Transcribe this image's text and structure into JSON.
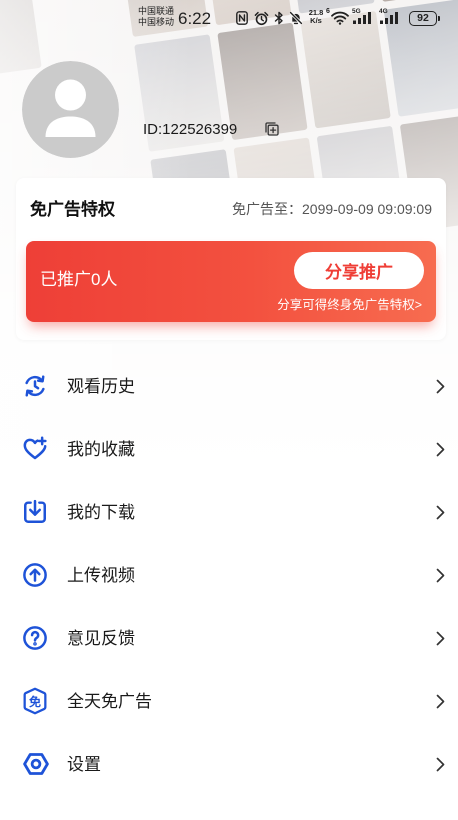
{
  "status_bar": {
    "carrier_1": "中国联通",
    "carrier_2": "中国移动",
    "time": "6:22",
    "net_speed_value": "21.8",
    "net_speed_unit": "K/s",
    "wifi_badge": "6",
    "signal_1_label": "5G",
    "signal_2_label": "4G",
    "battery_level": "92",
    "icons": [
      "nfc-icon",
      "alarm-icon",
      "bluetooth-icon",
      "bell-mute-icon",
      "wifi-icon",
      "signal-5g-icon",
      "signal-4g-icon",
      "battery-icon"
    ]
  },
  "profile": {
    "avatar_icon": "default-avatar-person-icon",
    "id_text": "ID:122526399",
    "copy_icon": "copy-icon"
  },
  "ad_free_card": {
    "title": "免广告特权",
    "expiry_text": "免广告至：2099-09-09 09:09:09",
    "promo_banner": {
      "promoted_text": "已推广0人",
      "share_button_label": "分享推广",
      "share_hint": "分享可得终身免广告特权>"
    }
  },
  "menu": {
    "items": [
      {
        "label": "观看历史",
        "icon": "history-icon"
      },
      {
        "label": "我的收藏",
        "icon": "heart-plus-icon"
      },
      {
        "label": "我的下载",
        "icon": "download-icon"
      },
      {
        "label": "上传视频",
        "icon": "upload-icon"
      },
      {
        "label": "意见反馈",
        "icon": "question-feedback-icon"
      },
      {
        "label": "全天免广告",
        "icon": "ad-free-badge-icon",
        "icon_text": "免"
      },
      {
        "label": "设置",
        "icon": "settings-icon"
      }
    ],
    "chevron_icon": "chevron-right-icon"
  },
  "colors": {
    "accent_blue": "#1e53d8",
    "banner_red_start": "#ee3f37",
    "banner_red_end": "#f76c50",
    "share_button_text": "#ef3e36",
    "text_primary": "#1a1a1a",
    "text_secondary": "#555555"
  }
}
